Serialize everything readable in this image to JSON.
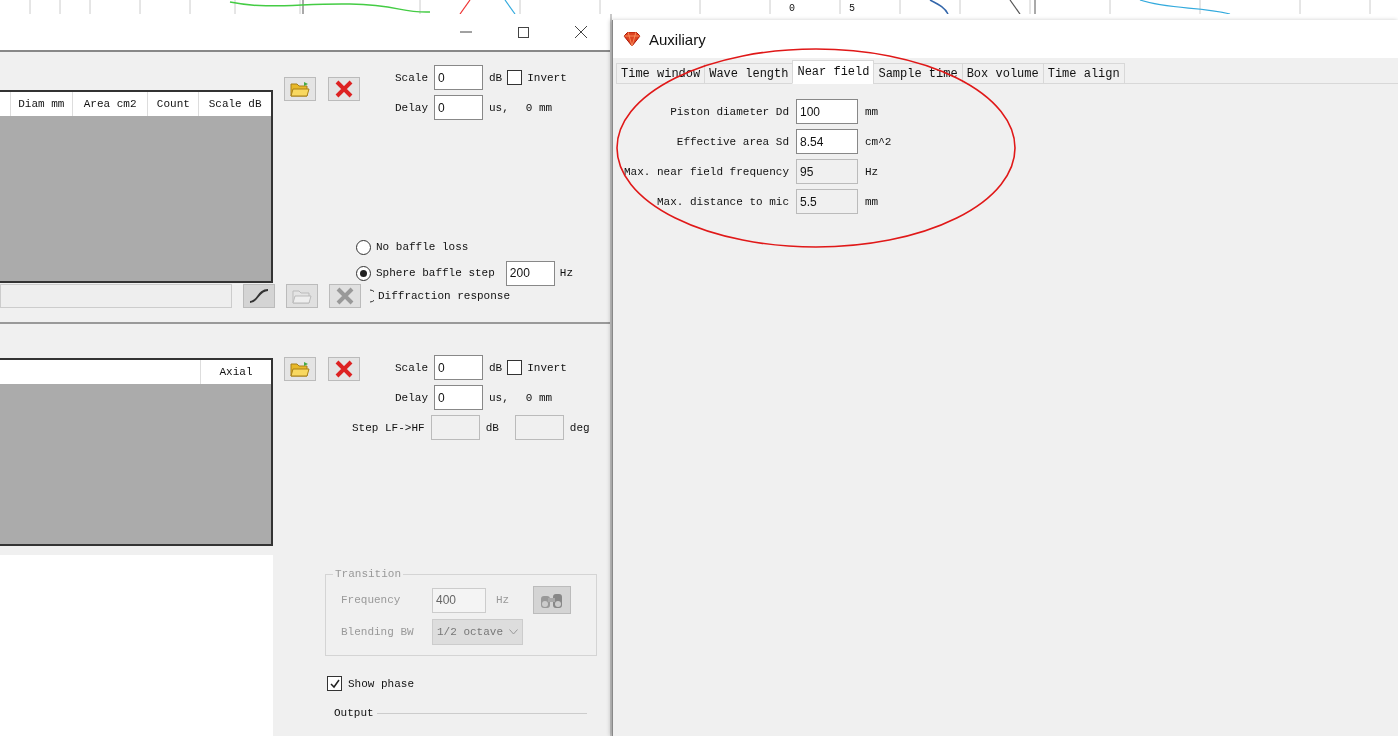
{
  "background_chart": {
    "labels": [
      "0",
      "5"
    ]
  },
  "main_window": {
    "driver_panel": {
      "table": {
        "columns": [
          "Diam mm",
          "Area cm2",
          "Count",
          "Scale dB"
        ]
      },
      "buttons": [
        {
          "kind": "open",
          "disabled": false
        },
        {
          "kind": "delete",
          "disabled": false
        }
      ],
      "scale": {
        "label": "Scale",
        "value": "0",
        "unit": "dB"
      },
      "invert": {
        "label": "Invert",
        "checked": false
      },
      "delay": {
        "label": "Delay",
        "value": "0",
        "unit": "us,",
        "distance": "0 mm"
      },
      "baffle_options": [
        {
          "label": "No baffle loss",
          "selected": false
        },
        {
          "label": "Sphere baffle step",
          "selected": true,
          "value": "200",
          "unit": "Hz"
        }
      ],
      "file_buttons": [
        {
          "kind": "curve",
          "disabled": false
        },
        {
          "kind": "open",
          "disabled": true
        },
        {
          "kind": "delete",
          "disabled": true
        }
      ],
      "diffraction": {
        "label": "Diffraction response",
        "selected": false
      }
    },
    "response_panel": {
      "table": {
        "columns": [
          "Axial"
        ]
      },
      "buttons": [
        {
          "kind": "open",
          "disabled": false
        },
        {
          "kind": "delete",
          "disabled": false
        }
      ],
      "scale": {
        "label": "Scale",
        "value": "0",
        "unit": "dB"
      },
      "invert": {
        "label": "Invert",
        "checked": false
      },
      "delay": {
        "label": "Delay",
        "value": "0",
        "unit": "us,",
        "distance": "0 mm"
      },
      "step": {
        "label": "Step LF->HF",
        "db_unit": "dB",
        "deg_unit": "deg",
        "disabled": true
      },
      "transition": {
        "title": "Transition",
        "disabled": true,
        "frequency": {
          "label": "Frequency",
          "value": "400",
          "unit": "Hz"
        },
        "blending": {
          "label": "Blending BW",
          "value": "1/2 octave"
        }
      },
      "show_phase": {
        "label": "Show phase",
        "checked": true
      },
      "output": {
        "title": "Output"
      }
    }
  },
  "auxiliary": {
    "title": "Auxiliary",
    "tabs": [
      {
        "label": "Time window",
        "selected": false
      },
      {
        "label": "Wave length",
        "selected": false
      },
      {
        "label": "Near field",
        "selected": true
      },
      {
        "label": "Sample time",
        "selected": false
      },
      {
        "label": "Box volume",
        "selected": false
      },
      {
        "label": "Time align",
        "selected": false
      }
    ],
    "fields": [
      {
        "label": "Piston diameter Dd",
        "value": "100",
        "unit": "mm",
        "disabled": false
      },
      {
        "label": "Effective area Sd",
        "value": "8.54",
        "unit": "cm^2",
        "disabled": false
      },
      {
        "label": "Max. near field frequency",
        "value": "95",
        "unit": "Hz",
        "disabled": true
      },
      {
        "label": "Max. distance to mic",
        "value": "5.5",
        "unit": "mm",
        "disabled": true
      }
    ]
  }
}
